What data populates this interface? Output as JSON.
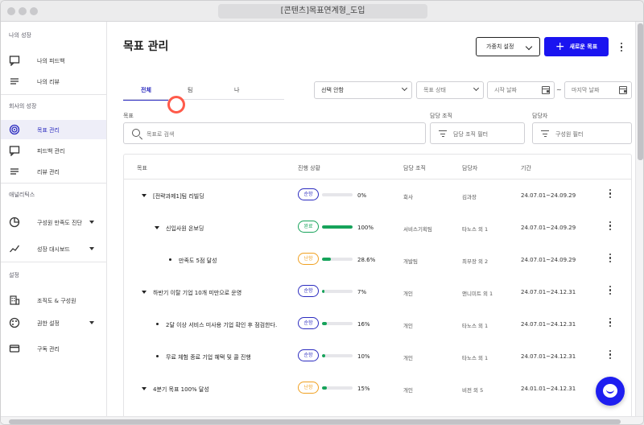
{
  "browser": {
    "url_title": "[콘텐츠]목표연계형_도입"
  },
  "sidebar": {
    "sections": [
      {
        "label": "나의 성장"
      },
      {
        "label": "회사의 성장"
      },
      {
        "label": "애널리틱스"
      },
      {
        "label": "설정"
      }
    ],
    "items": [
      {
        "label": "나의 피드백",
        "icon": "feedback-bubble-icon",
        "active": false
      },
      {
        "label": "나의 리뷰",
        "icon": "list-icon",
        "active": false
      },
      {
        "label": "목표 관리",
        "icon": "target-icon",
        "active": true
      },
      {
        "label": "피드백 관리",
        "icon": "feedback-bubble-icon",
        "active": false
      },
      {
        "label": "리뷰 관리",
        "icon": "list-icon",
        "active": false
      },
      {
        "label": "구성원 만족도 진단",
        "icon": "pie-chart-icon",
        "active": false,
        "expandable": true
      },
      {
        "label": "성장 대시보드",
        "icon": "trend-icon",
        "active": false,
        "expandable": true
      },
      {
        "label": "조직도 & 구성원",
        "icon": "building-icon",
        "active": false
      },
      {
        "label": "권한 설정",
        "icon": "palette-icon",
        "active": false,
        "expandable": true
      },
      {
        "label": "구독 관리",
        "icon": "card-icon",
        "active": false
      }
    ]
  },
  "header": {
    "title": "목표 관리",
    "weight_button": "가중치 설정",
    "new_goal_button": "새로운 목표"
  },
  "tabs": [
    {
      "label": "전체",
      "active": true
    },
    {
      "label": "팀",
      "active": false
    },
    {
      "label": "나",
      "active": false
    }
  ],
  "filters": {
    "select_none": "선택 안함",
    "goal_status_placeholder": "목표 상태",
    "start_date_placeholder": "시작 날짜",
    "date_separator": "~",
    "end_date_placeholder": "마지막 날짜"
  },
  "search": {
    "goal_label": "목표",
    "goal_placeholder": "목표로 검색",
    "org_label": "담당 조직",
    "org_placeholder": "담당 조직 필터",
    "owner_label": "담당자",
    "owner_placeholder": "구성원 필터"
  },
  "table": {
    "columns": [
      "목표",
      "진행 상황",
      "담당 조직",
      "담당자",
      "기간"
    ],
    "rows": [
      {
        "level": 0,
        "marker": "caret",
        "name": "[전략과제1]팀 리빌딩",
        "status": "순항",
        "progress": 0,
        "pct": "0%",
        "org": "회사",
        "owner": "김과장",
        "period": "24.07.01~24.09.29"
      },
      {
        "level": 1,
        "marker": "caret",
        "name": "신입사원 온보딩",
        "status": "완료",
        "progress": 100,
        "pct": "100%",
        "org": "서비스기획팀",
        "owner": "타노스 외 1",
        "period": "24.07.01~24.09.29"
      },
      {
        "level": 2,
        "marker": "bullet",
        "name": "만족도 5점 달성",
        "status": "난항",
        "progress": 28.6,
        "pct": "28.6%",
        "org": "개발팀",
        "owner": "최부장 외 2",
        "period": "24.07.01~24.09.29"
      },
      {
        "level": 0,
        "marker": "caret",
        "name": "하반기 이탈 기업 10개 미만으로 운영",
        "status": "순항",
        "progress": 7,
        "pct": "7%",
        "org": "개인",
        "owner": "앤니미트 외 1",
        "period": "24.07.01~24.12.31"
      },
      {
        "level": 1,
        "marker": "bullet",
        "name": "2달 이상 서비스 미사용 기업 확인 후 점검한다.",
        "status": "순항",
        "progress": 16,
        "pct": "16%",
        "org": "개인",
        "owner": "타노스 외 1",
        "period": "24.07.01~24.12.31"
      },
      {
        "level": 1,
        "marker": "bullet",
        "name": "무료 체험 종료 기업 혜택 및 콜 진행",
        "status": "순항",
        "progress": 10,
        "pct": "10%",
        "org": "개인",
        "owner": "타노스 외 1",
        "period": "24.07.01~24.12.31"
      },
      {
        "level": 0,
        "marker": "caret",
        "name": "4분기 목표 100% 달성",
        "status": "난항",
        "progress": 15,
        "pct": "15%",
        "org": "개인",
        "owner": "비전 외 5",
        "period": "24.01.01~24.12.31"
      }
    ]
  },
  "status_colors": {
    "순항": "#2b2bbf",
    "완료": "#16a35a",
    "난항": "#f0a020"
  }
}
